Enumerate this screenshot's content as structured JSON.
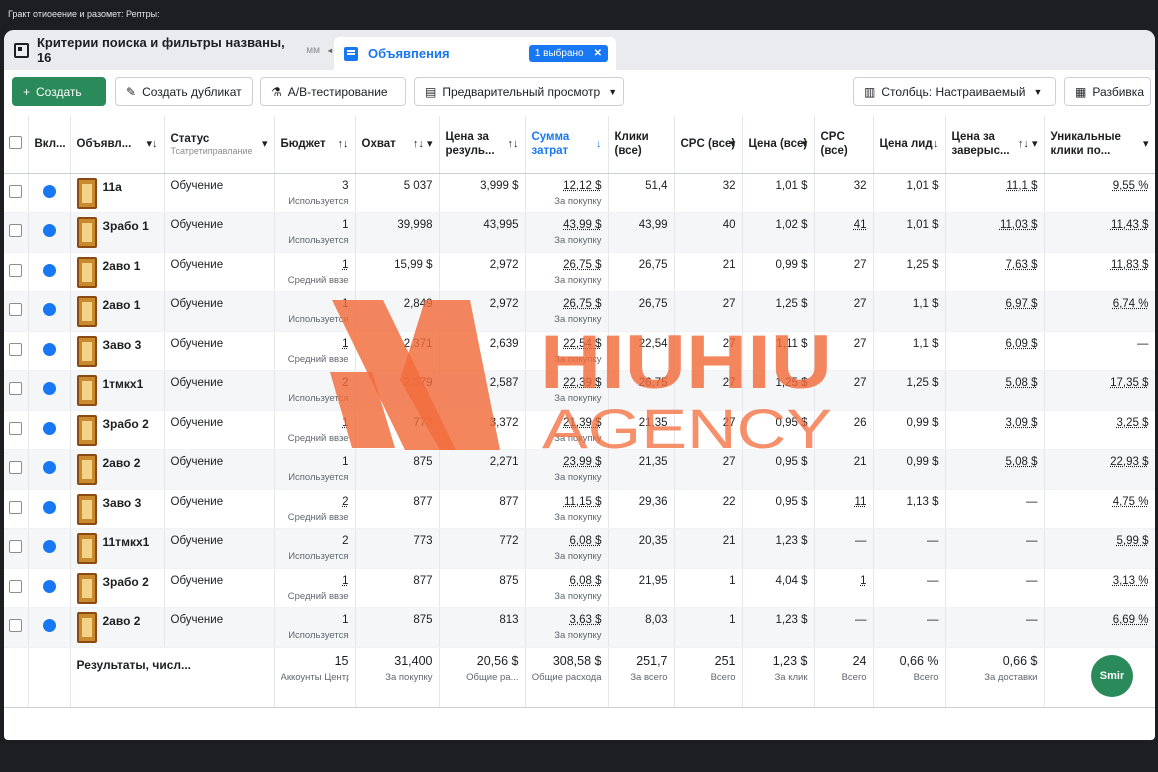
{
  "window": {
    "title": "Гракт отиоеение и разомет: Рептры:"
  },
  "tabs": [
    {
      "label": "Критерии поиска и фильтры названы, 16",
      "suffix": "мм"
    },
    {
      "label": "Объявпения",
      "badge": "1 выбрано"
    }
  ],
  "toolbar": {
    "create": "Создать",
    "duplicate": "Создать дубликат",
    "ab_test": "А/В-тестирование",
    "preview": "Предварительный просмотр",
    "columns": "Столбць: Настраиваемый",
    "breakdown": "Разбивка"
  },
  "headers": {
    "on": "Вкл...",
    "ad": "Объявл...",
    "status": "Статус",
    "status_sub": "Тсатретиправлание",
    "budget": "Бюджет",
    "reach": "Охват",
    "cost_result": "Цена за резуль...",
    "spend": "Сумма затрат",
    "clicks": "Клики (все)",
    "cpc": "CPC (все)",
    "price": "Цена (все)",
    "cpc2": "CPC (все)",
    "lead_price": "Цена лид",
    "cost_complete": "Цена за заверыс...",
    "unique_clicks": "Уникальные клики по..."
  },
  "rows": [
    {
      "name": "11а",
      "status": "Обучение",
      "budget": "3",
      "budget_sub": "Используется",
      "reach": "5 037",
      "cost_result": "3,999 $",
      "spend": "12,12 $",
      "spend_sub": "За покупку",
      "clicks": "51,4",
      "cpc": "32",
      "price": "1,01 $",
      "cpc2": "32",
      "lead": "1,01 $",
      "complete": "11,1 $",
      "unique": "9,55 %"
    },
    {
      "name": "Зрабо 1",
      "status": "Обучение",
      "budget": "1",
      "budget_sub": "Используется",
      "reach": "39,998",
      "cost_result": "43,995",
      "spend": "43,99 $",
      "spend_sub": "За покупку",
      "clicks": "43,99",
      "cpc": "40",
      "price": "1,02 $",
      "cpc2": "41",
      "lead": "1,01 $",
      "complete": "11,03 $",
      "unique": "11,43 $"
    },
    {
      "name": "2аво 1",
      "status": "Обучение",
      "budget": "1",
      "budget_sub": "Средний ввзе",
      "reach": "15,99 $",
      "cost_result": "2,972",
      "spend": "26,75 $",
      "spend_sub": "За покупку",
      "clicks": "26,75",
      "cpc": "21",
      "price": "0,99 $",
      "cpc2": "27",
      "lead": "1,25 $",
      "complete": "7,63 $",
      "unique": "11,83 $"
    },
    {
      "name": "2аво 1",
      "status": "Обучение",
      "budget": "1",
      "budget_sub": "Используется",
      "reach": "2,849",
      "cost_result": "2,972",
      "spend": "26,75 $",
      "spend_sub": "За покупку",
      "clicks": "26,75",
      "cpc": "27",
      "price": "1,25 $",
      "cpc2": "27",
      "lead": "1,1 $",
      "complete": "6,97 $",
      "unique": "6,74 %"
    },
    {
      "name": "Заво 3",
      "status": "Обучение",
      "budget": "1",
      "budget_sub": "Средний ввзе",
      "reach": "2,371",
      "cost_result": "2,639",
      "spend": "22,54 $",
      "spend_sub": "За покупку",
      "clicks": "22,54",
      "cpc": "27",
      "price": "1,11 $",
      "cpc2": "27",
      "lead": "1,1 $",
      "complete": "6,09 $",
      "unique": "—"
    },
    {
      "name": "1тмкх1",
      "status": "Обучение",
      "budget": "2",
      "budget_sub": "Используется",
      "reach": "2,379",
      "cost_result": "2,587",
      "spend": "22,39 $",
      "spend_sub": "За покупку",
      "clicks": "26,75",
      "cpc": "27",
      "price": "1,25 $",
      "cpc2": "27",
      "lead": "1,25 $",
      "complete": "5,08 $",
      "unique": "17,35 $"
    },
    {
      "name": "Зрабо 2",
      "status": "Обучение",
      "budget": "1",
      "budget_sub": "Средний ввзе",
      "reach": "773",
      "cost_result": "3,372",
      "spend": "21,39 $",
      "spend_sub": "За покупку",
      "clicks": "21,35",
      "cpc": "27",
      "price": "0,95 $",
      "cpc2": "26",
      "lead": "0,99 $",
      "complete": "3,09 $",
      "unique": "3,25 $"
    },
    {
      "name": "2аво 2",
      "status": "Обучение",
      "budget": "1",
      "budget_sub": "Используется",
      "reach": "875",
      "cost_result": "2,271",
      "spend": "23,99 $",
      "spend_sub": "За покупку",
      "clicks": "21,35",
      "cpc": "27",
      "price": "0,95 $",
      "cpc2": "21",
      "lead": "0,99 $",
      "complete": "5,08 $",
      "unique": "22,93 $"
    },
    {
      "name": "Заво 3",
      "status": "Обучение",
      "budget": "2",
      "budget_sub": "Средний ввзе",
      "reach": "877",
      "cost_result": "877",
      "spend": "11,15 $",
      "spend_sub": "За покупку",
      "clicks": "29,36",
      "cpc": "22",
      "price": "0,95 $",
      "cpc2": "11",
      "lead": "1,13 $",
      "complete": "—",
      "unique": "4,75 %"
    },
    {
      "name": "11тмкх1",
      "status": "Обучение",
      "budget": "2",
      "budget_sub": "Используется",
      "reach": "773",
      "cost_result": "772",
      "spend": "6,08 $",
      "spend_sub": "За покупку",
      "clicks": "20,35",
      "cpc": "21",
      "price": "1,23 $",
      "cpc2": "—",
      "lead": "—",
      "complete": "—",
      "unique": "5,99 $"
    },
    {
      "name": "Зрабо 2",
      "status": "Обучение",
      "budget": "1",
      "budget_sub": "Средний ввзе",
      "reach": "877",
      "cost_result": "875",
      "spend": "6,08 $",
      "spend_sub": "За покупку",
      "clicks": "21,95",
      "cpc": "1",
      "price": "4,04 $",
      "cpc2": "1",
      "lead": "—",
      "complete": "—",
      "unique": "3,13 %"
    },
    {
      "name": "2аво 2",
      "status": "Обучение",
      "budget": "1",
      "budget_sub": "Используется",
      "reach": "875",
      "cost_result": "813",
      "spend": "3,63 $",
      "spend_sub": "За покупку",
      "clicks": "8,03",
      "cpc": "1",
      "price": "1,23 $",
      "cpc2": "—",
      "lead": "—",
      "complete": "—",
      "unique": "6,69 %"
    }
  ],
  "totals": {
    "label": "Результаты, числ...",
    "budget": "15",
    "budget_sub": "Аккоунты Центр...",
    "reach": "31,400",
    "reach_sub": "За покупку",
    "cost_result": "20,56 $",
    "cost_result_sub": "Общие ра...",
    "spend": "308,58 $",
    "spend_sub": "Общие расхода",
    "clicks": "251,7",
    "clicks_sub": "За всего",
    "cpc": "251",
    "cpc_sub": "Всего",
    "price": "1,23 $",
    "price_sub": "За клик",
    "cpc2": "24",
    "cpc2_sub": "Всего",
    "lead": "0,66 %",
    "lead_sub": "Всего",
    "complete": "0,66 $",
    "complete_sub": "За доставки"
  },
  "watermark": {
    "brand": "HIUHIU",
    "sub": "AGENCY",
    "color": "#f26b3a"
  },
  "chat_button": "Smir",
  "colors": {
    "accent": "#1877f2",
    "create": "#2b8a5a"
  }
}
